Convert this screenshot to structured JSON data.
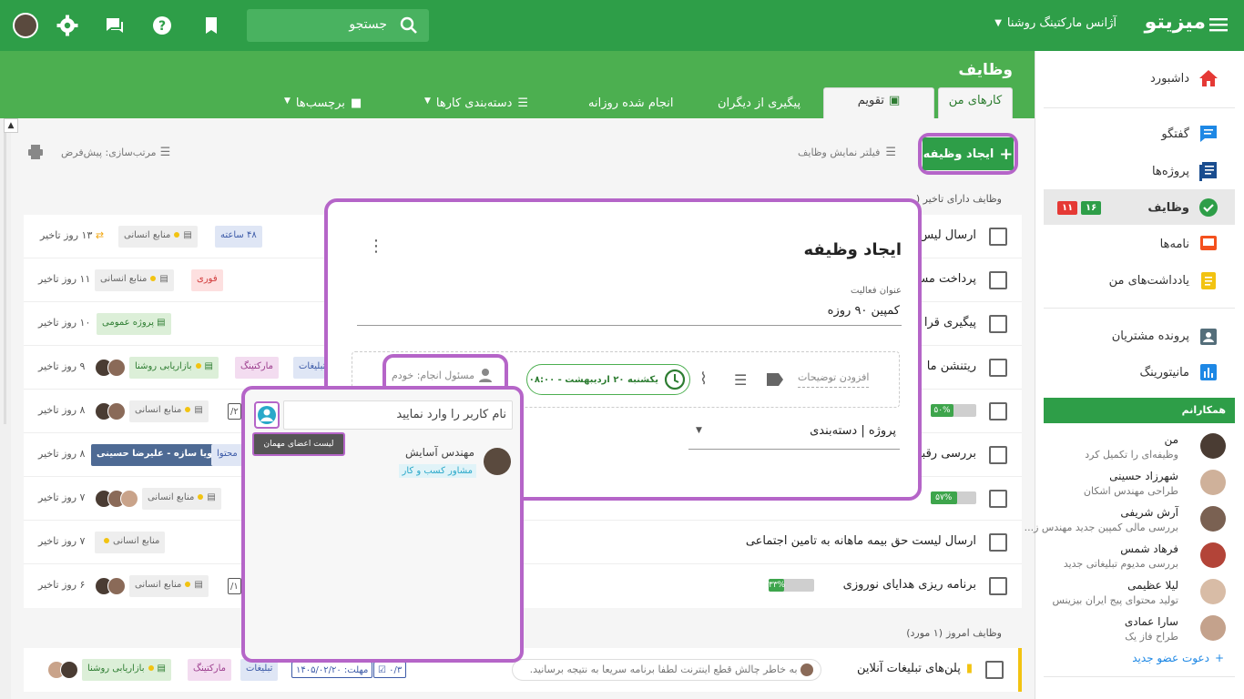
{
  "header": {
    "brand": "میزیتو",
    "org": "آژانس مارکتینگ روشنا",
    "search_placeholder": "جستجو"
  },
  "page": {
    "title": "وظایف",
    "tabs": [
      {
        "label": "کارهای من"
      },
      {
        "label": "تقویم"
      },
      {
        "label": "پیگیری از دیگران"
      },
      {
        "label": "انجام شده روزانه"
      },
      {
        "label": "دسته‌بندی کارها"
      },
      {
        "label": "برچسب‌ها"
      }
    ]
  },
  "toolbar": {
    "create_label": "ایجاد وظیفه",
    "filter_label": "فیلتر نمایش وظایف",
    "sort_label": "مرتب‌سازی: پیش‌فرض"
  },
  "sections": {
    "overdue": "وظایف دارای تاخیر (",
    "today": "وظایف امروز",
    "today_count": "(۱ مورد)"
  },
  "rows": [
    {
      "title": "ارسال لیس",
      "delay": "۱۳ روز تاخیر",
      "t1": "منابع انسانی",
      "t2": "۴۸ ساعته"
    },
    {
      "title": "پرداخت مس",
      "delay": "۱۱ روز تاخیر",
      "t1": "منابع انسانی",
      "t2": "فوری"
    },
    {
      "title": "پیگیری قرا",
      "delay": "۱۰ روز تاخیر",
      "t1": "پروژه عمومی"
    },
    {
      "title": "ریتنشن ما",
      "delay": "۹ روز تاخیر",
      "t1": "بازاریابی روشنا",
      "t2": "مارکتینگ",
      "t3": "تبلیغات"
    },
    {
      "title": "",
      "delay": "۸ روز تاخیر",
      "t1": "منابع انسانی",
      "prog": "۵۰%",
      "counter": "۲/"
    },
    {
      "title": "بررسی رقبا",
      "delay": "۸ روز تاخیر",
      "t1": "پویا سازه - علیرضا حسینی",
      "t2": "محتوا"
    },
    {
      "title": "",
      "delay": "۷ روز تاخیر",
      "t1": "منابع انسانی",
      "prog": "۵۷%"
    },
    {
      "title": "ارسال لیست حق بیمه ماهانه به تامین اجتماعی",
      "delay": "۷ روز تاخیر",
      "t1": "منابع انسانی"
    },
    {
      "title": "برنامه ریزی هدایای نوروزی",
      "delay": "۶ روز تاخیر",
      "t1": "منابع انسانی",
      "prog": "۳۳%",
      "counter": "۱/"
    }
  ],
  "today_row": {
    "title": "پلن‌های تبلیغات آنلاین",
    "comment": "به خاطر چالش قطع اینترنت لطفا برنامه سریعا به نتیجه برسانید.",
    "deadline": "مهلت: ۱۴۰۵/۰۲/۲۰",
    "checklist": "۰/۳",
    "tags": [
      "تبلیغات",
      "مارکتینگ",
      "بازاریابی روشنا"
    ]
  },
  "dialog": {
    "title": "ایجاد وظیفه",
    "activity_label": "عنوان فعالیت",
    "activity_value": "کمپین ۹۰ روزه",
    "assignee": "مسئول انجام: خودم",
    "date_chip": "یکشنبه ۲۰ اردیبهشت - ۰۸:۰۰",
    "desc_placeholder": "افزودن توضیحات",
    "project_label": "پروژه | دسته‌بندی"
  },
  "popup": {
    "input_placeholder": "نام کاربر را وارد نمایید",
    "tooltip": "لیست اعضای مهمان",
    "user_name": "مهندس آسایش",
    "user_role": "مشاور کسب و کار"
  },
  "sidebar": {
    "items": [
      {
        "label": "داشبورد"
      },
      {
        "label": "گفتگو"
      },
      {
        "label": "پروژه‌ها"
      },
      {
        "label": "وظایف",
        "badge_green": "۱۶",
        "badge_red": "۱۱"
      },
      {
        "label": "نامه‌ها"
      },
      {
        "label": "یادداشت‌های من"
      },
      {
        "label": "پرونده مشتریان"
      },
      {
        "label": "مانیتورینگ"
      }
    ],
    "colleagues_title": "همکارانم",
    "members": [
      {
        "name": "من",
        "status": "وظیفه‌ای را تکمیل کرد"
      },
      {
        "name": "شهرزاد حسینی",
        "status": "طراحی مهندس اشکان"
      },
      {
        "name": "آرش شریفی",
        "status": "بررسی مالی کمپین جدید مهندس ز..."
      },
      {
        "name": "فرهاد شمس",
        "status": "بررسی مدیوم تبلیغاتی جدید"
      },
      {
        "name": "لیلا عظیمی",
        "status": "تولید محتوای پیج ایران بیزینس"
      },
      {
        "name": "سارا عمادی",
        "status": "طراح فاز یک"
      }
    ],
    "invite": "دعوت عضو جدید"
  },
  "colors": {
    "primary": "#2e9e48",
    "accent": "#b565c8",
    "overdue": "#e53935",
    "today": "#f2c311"
  }
}
